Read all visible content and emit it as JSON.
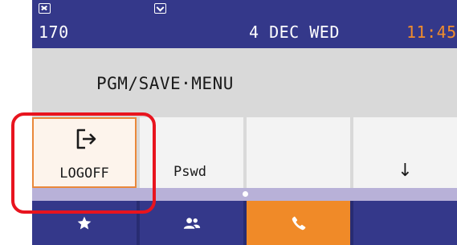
{
  "status_bar": {
    "extension": "170",
    "date": "4 DEC WED",
    "time": "11:45",
    "icons": [
      "extension-icon",
      "mail-icon"
    ],
    "time_color": "#f08c2c"
  },
  "menu": {
    "title": "PGM/SAVE·MENU"
  },
  "softkeys": [
    {
      "label": "LOGOFF",
      "icon": "logoff-icon",
      "selected": true
    },
    {
      "label": "Pswd"
    },
    {
      "label": ""
    },
    {
      "label": "↓",
      "icon": "arrow-down-icon"
    }
  ],
  "page_indicator": {
    "current_page": 1,
    "total_pages": 1
  },
  "navbar": {
    "items": [
      {
        "icon": "star-icon",
        "active": false
      },
      {
        "icon": "contacts-icon",
        "active": false
      },
      {
        "icon": "phone-icon",
        "active": true
      },
      {
        "icon": "",
        "active": false
      }
    ]
  },
  "colors": {
    "header_blue": "#34388a",
    "accent_orange": "#f08a28",
    "highlight_red": "#e8141e",
    "page_bar": "#b8b1d8"
  }
}
